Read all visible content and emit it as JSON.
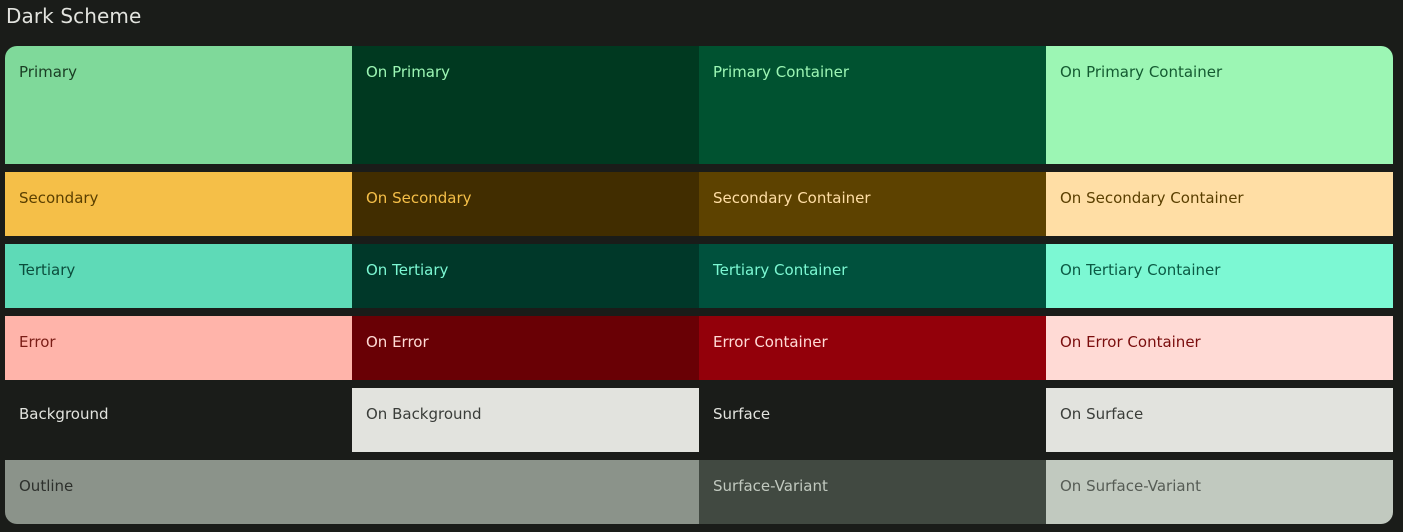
{
  "title": "Dark Scheme",
  "rows": {
    "primary": [
      {
        "label": "Primary",
        "bg": "#7fd99a",
        "fg": "#1a3d24"
      },
      {
        "label": "On Primary",
        "bg": "#003920",
        "fg": "#9cf6b4"
      },
      {
        "label": "Primary Container",
        "bg": "#005230",
        "fg": "#9cf6b4"
      },
      {
        "label": "On Primary Container",
        "bg": "#9cf6b4",
        "fg": "#145a31"
      }
    ],
    "secondary": [
      {
        "label": "Secondary",
        "bg": "#f5bf48",
        "fg": "#5a3f00"
      },
      {
        "label": "On Secondary",
        "bg": "#412d00",
        "fg": "#f5bf48"
      },
      {
        "label": "Secondary Container",
        "bg": "#5d4200",
        "fg": "#ffdea5"
      },
      {
        "label": "On Secondary Container",
        "bg": "#ffdea5",
        "fg": "#5a3f00"
      }
    ],
    "tertiary": [
      {
        "label": "Tertiary",
        "bg": "#5edab7",
        "fg": "#0b4d3c"
      },
      {
        "label": "On Tertiary",
        "bg": "#003829",
        "fg": "#7cf8d3"
      },
      {
        "label": "Tertiary Container",
        "bg": "#00513d",
        "fg": "#7cf8d3"
      },
      {
        "label": "On Tertiary Container",
        "bg": "#7cf8d3",
        "fg": "#0b5a44"
      }
    ],
    "error": [
      {
        "label": "Error",
        "bg": "#ffb4aa",
        "fg": "#7a1d16"
      },
      {
        "label": "On Error",
        "bg": "#690005",
        "fg": "#ffdad5"
      },
      {
        "label": "Error Container",
        "bg": "#93000a",
        "fg": "#ffdad5"
      },
      {
        "label": "On Error Container",
        "bg": "#ffdad5",
        "fg": "#7a0d0d"
      }
    ],
    "background": [
      {
        "label": "Background",
        "bg": "#1a1c19",
        "fg": "#e2e3de"
      },
      {
        "label": "On Background",
        "bg": "#e2e3de",
        "fg": "#3a3d39"
      },
      {
        "label": "Surface",
        "bg": "#1a1c19",
        "fg": "#e2e3de"
      },
      {
        "label": "On Surface",
        "bg": "#e2e3de",
        "fg": "#3a3d39"
      }
    ],
    "outline": [
      {
        "label": "Outline",
        "bg": "#8b938a",
        "fg": "#2d302c"
      },
      {
        "label": "Surface-Variant",
        "bg": "#414941",
        "fg": "#c1c9bf"
      },
      {
        "label": "On Surface-Variant",
        "bg": "#c1c9bf",
        "fg": "#565c55"
      }
    ]
  }
}
